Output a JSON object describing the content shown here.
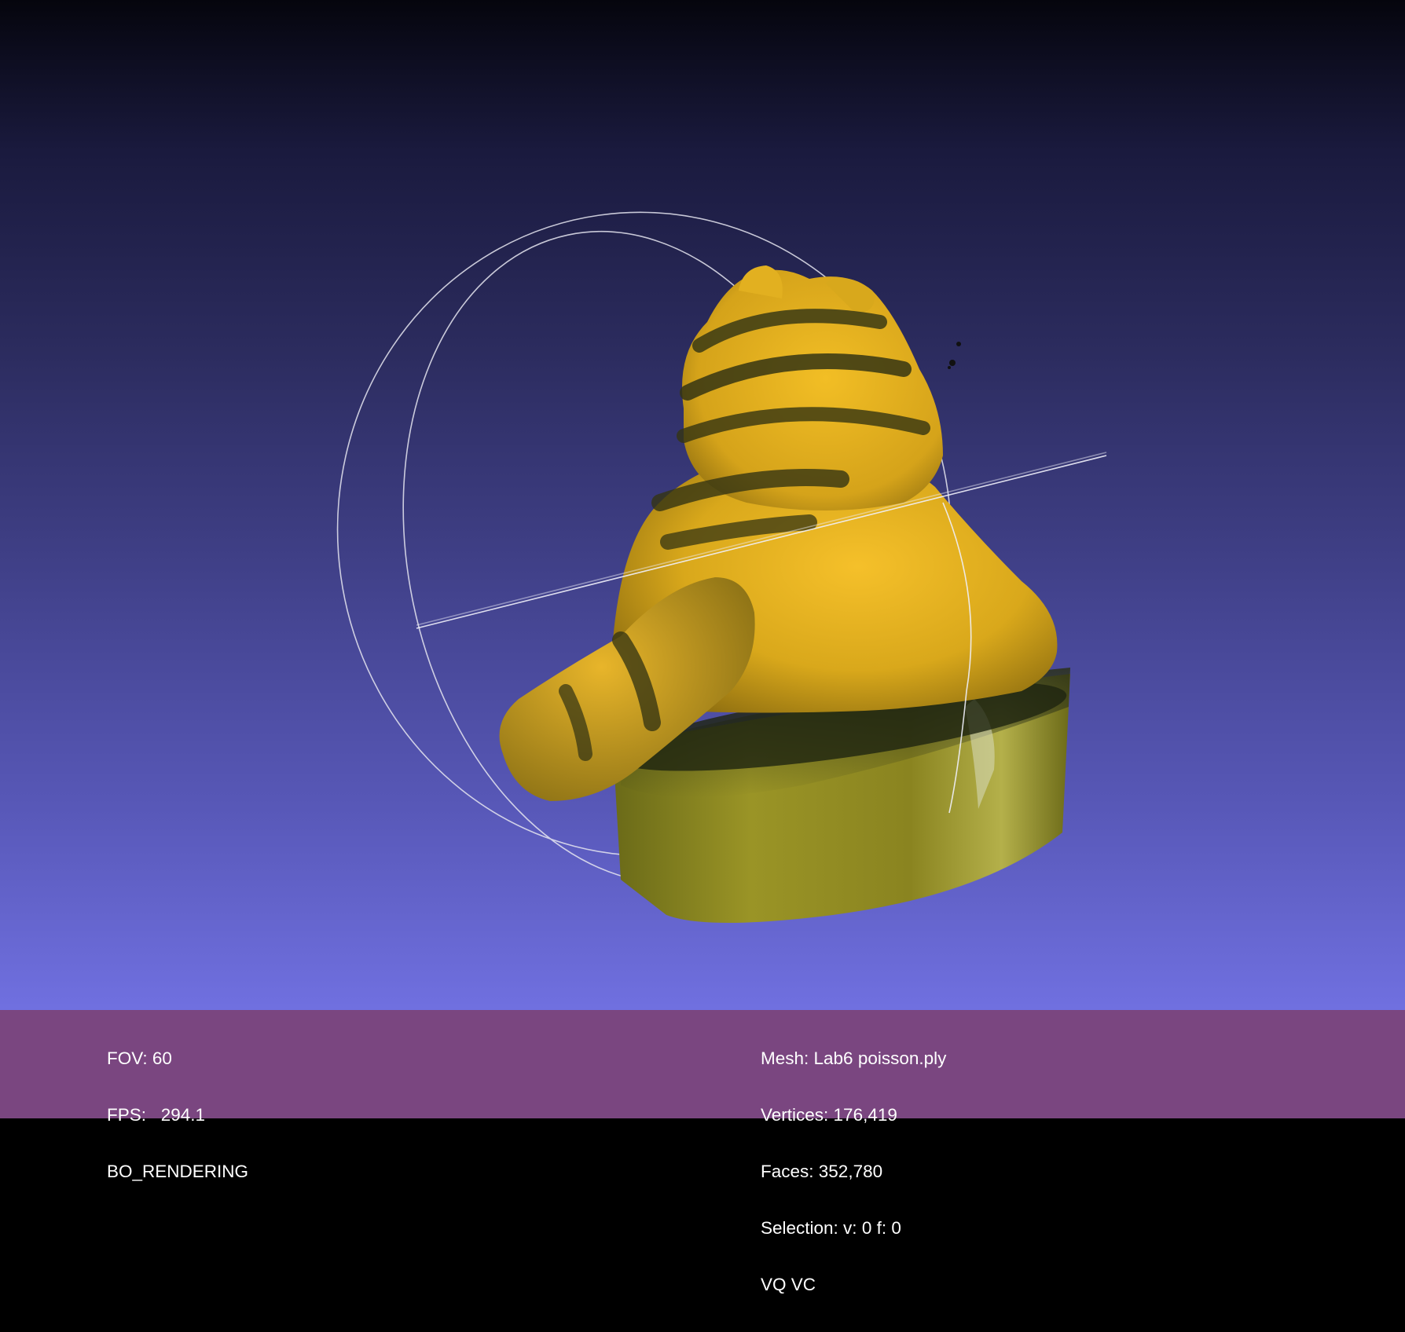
{
  "viewport": {
    "gradient_colors": [
      "#05050d",
      "#2c2c5f",
      "#5858b8",
      "#7070e0"
    ],
    "model": {
      "description_icon": "garfield-statue-mesh",
      "body_color": "#e0b21a",
      "stripe_color": "#3a3a14",
      "base_color": "#7a7a1c",
      "trackball_color": "#e6e6f0"
    }
  },
  "status_bar": {
    "background": "#7a4680",
    "left": {
      "fov": "FOV: 60",
      "fps": "FPS:   294.1",
      "render_mode": "BO_RENDERING"
    },
    "right": {
      "mesh": "Mesh: Lab6 poisson.ply",
      "vertices": "Vertices: 176,419",
      "faces": "Faces: 352,780",
      "selection": "Selection: v: 0 f: 0",
      "flags": "VQ VC"
    }
  }
}
